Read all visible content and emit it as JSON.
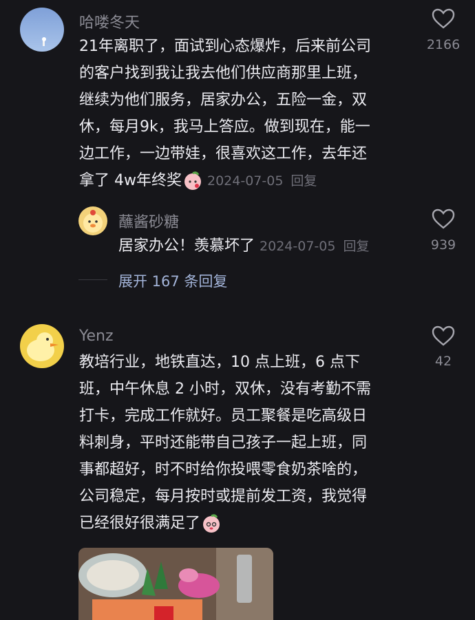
{
  "comments": [
    {
      "username": "哈喽冬天",
      "lines": [
        "21年离职了，面试到心态爆炸，后来前公司",
        "的客户找到我让我去他们供应商那里上班，",
        "继续为他们服务，居家办公，五险一金，双",
        "休，每月9k，我马上答应。做到现在，能一",
        "边工作，一边带娃，很喜欢这工作，去年还",
        "拿了 4w年终奖"
      ],
      "date": "2024-07-05",
      "reply_label": "回复",
      "likes": "2166"
    },
    {
      "username": "Yenz",
      "lines": [
        "教培行业，地铁直达，10 点上班，6 点下",
        "班，中午休息 2 小时，双休，没有考勤不需",
        "打卡，完成工作就好。员工聚餐是吃高级日",
        "料刺身，平时还能带自己孩子一起上班，同",
        "事都超好，时不时给你投喂零食奶茶啥的，",
        "公司稳定，每月按时或提前发工资，我觉得",
        "已经很好很满足了"
      ],
      "likes": "42"
    }
  ],
  "reply": {
    "username": "蘸酱砂糖",
    "text": "居家办公！羡慕坏了",
    "date": "2024-07-05",
    "reply_label": "回复",
    "likes": "939"
  },
  "expand_replies": "展开 167 条回复"
}
